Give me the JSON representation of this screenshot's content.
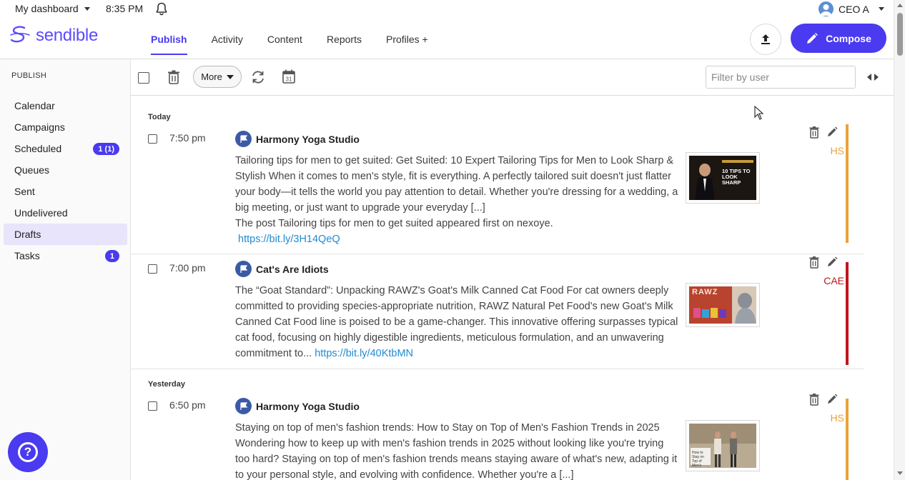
{
  "topbar": {
    "dashboard_label": "My dashboard",
    "time": "8:35 PM",
    "user_name": "CEO A"
  },
  "header": {
    "logo_text": "sendible",
    "nav": [
      {
        "label": "Publish",
        "active": true
      },
      {
        "label": "Activity"
      },
      {
        "label": "Content"
      },
      {
        "label": "Reports"
      },
      {
        "label": "Profiles +"
      }
    ],
    "compose_label": "Compose"
  },
  "sidebar": {
    "title": "PUBLISH",
    "items": [
      {
        "label": "Calendar"
      },
      {
        "label": "Campaigns"
      },
      {
        "label": "Scheduled",
        "badge": "1 (1)"
      },
      {
        "label": "Queues"
      },
      {
        "label": "Sent"
      },
      {
        "label": "Undelivered"
      },
      {
        "label": "Drafts",
        "active": true
      },
      {
        "label": "Tasks",
        "badge": "1"
      }
    ]
  },
  "toolbar": {
    "more_label": "More",
    "filter_placeholder": "Filter by user",
    "calendar_day": "31"
  },
  "groups": [
    {
      "label": "Today"
    },
    {
      "label": "Yesterday"
    }
  ],
  "posts": [
    {
      "time": "7:50 pm",
      "profile": "Harmony Yoga Studio",
      "text": "Tailoring tips for men to get suited: Get Suited: 10 Expert Tailoring Tips for Men to Look Sharp & Stylish When it comes to men's style, fit is everything. A perfectly tailored suit doesn't just flatter your body—it tells the world you pay attention to detail. Whether you're dressing for a wedding, a big meeting, or just want to upgrade your everyday [...]",
      "text2": "The post Tailoring tips for men to get suited appeared first on nexoye.",
      "link": "https://bit.ly/3H14QeQ",
      "initials": "HS",
      "color": "#e8a23b",
      "thumb_title": "10 TIPS TO LOOK SHARP"
    },
    {
      "time": "7:00 pm",
      "profile": "Cat's Are Idiots",
      "text": "The “Goat Standard”: Unpacking RAWZ's Goat's Milk Canned Cat Food For cat owners deeply committed to providing species-appropriate nutrition, RAWZ Natural Pet Food's new Goat's Milk Canned Cat Food line is poised to be a game-changer. This innovative offering surpasses typical cat food, focusing on highly digestible ingredients, meticulous formulation, and an unwavering commitment to...",
      "link": "https://bit.ly/40KtbMN",
      "initials": "CAE",
      "color": "#c0151d",
      "thumb_title": "RAWZ"
    },
    {
      "time": "6:50 pm",
      "profile": "Harmony Yoga Studio",
      "text": "Staying on top of men's fashion trends: How to Stay on Top of Men's Fashion Trends in 2025 Wondering how to keep up with men's fashion trends in 2025 without looking like you're trying too hard? Staying on top of men's fashion trends means staying aware of what's new, adapting it to your personal style, and evolving with confidence. Whether you're a [...]",
      "initials": "HS",
      "color": "#e8a23b",
      "thumb_title": "How to Stay on Top of Men's Fashion Trends"
    }
  ]
}
